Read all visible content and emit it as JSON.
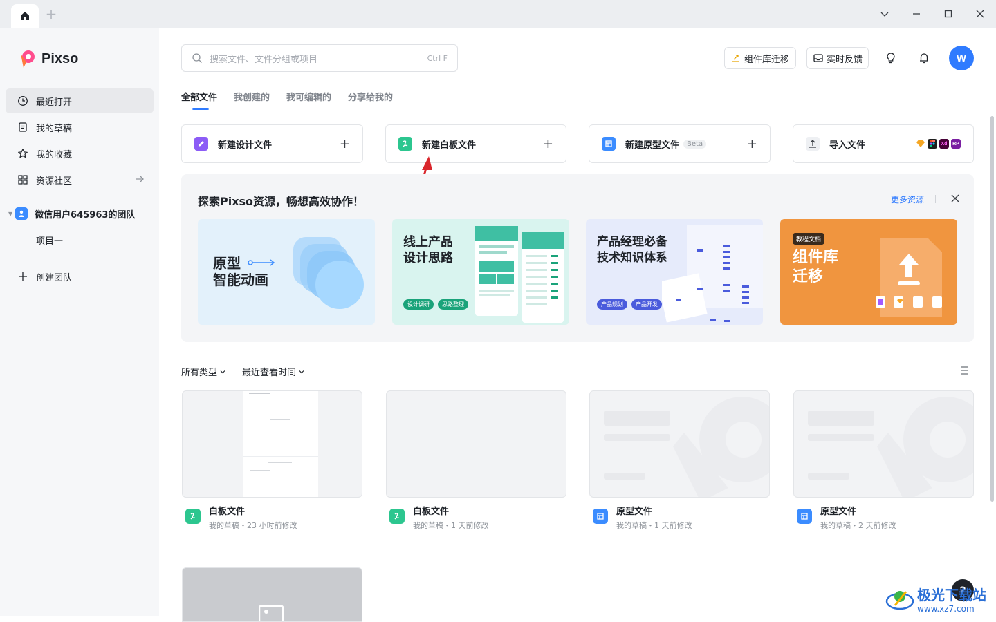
{
  "app": {
    "name": "Pixso"
  },
  "sidebar": {
    "items": [
      {
        "label": "最近打开",
        "icon": "clock-icon"
      },
      {
        "label": "我的草稿",
        "icon": "draft-icon"
      },
      {
        "label": "我的收藏",
        "icon": "star-icon"
      },
      {
        "label": "资源社区",
        "icon": "grid-icon"
      }
    ],
    "team": {
      "name": "微信用户645963的团队",
      "project": "项目一"
    },
    "create_team": "创建团队"
  },
  "search": {
    "placeholder": "搜索文件、文件分组或项目",
    "shortcut": "Ctrl F"
  },
  "header": {
    "migrate_label": "组件库迁移",
    "feedback_label": "实时反馈",
    "avatar_letter": "W"
  },
  "tabs": [
    "全部文件",
    "我创建的",
    "我可编辑的",
    "分享给我的"
  ],
  "create": {
    "design": "新建设计文件",
    "whiteboard": "新建白板文件",
    "prototype": "新建原型文件",
    "beta": "Beta",
    "import": "导入文件",
    "formats": [
      "Sketch",
      "Figma",
      "Xd",
      "RP"
    ]
  },
  "resources": {
    "title": "探索Pixso资源，畅想高效协作！",
    "more": "更多资源",
    "cards": [
      {
        "title_line1": "原型",
        "title_line2": "智能动画"
      },
      {
        "title_line1": "线上产品",
        "title_line2": "设计思路",
        "tags": [
          "设计调研",
          "思路整理"
        ]
      },
      {
        "title_line1": "产品经理必备",
        "title_line2": "技术知识体系",
        "tags": [
          "产品规划",
          "产品开发"
        ]
      },
      {
        "badge": "教程文档",
        "title_line1": "组件库",
        "title_line2": "迁移"
      }
    ]
  },
  "filters": {
    "type": "所有类型",
    "sort": "最近查看时间"
  },
  "files": [
    {
      "name": "白板文件",
      "meta": "我的草稿・23 小时前修改",
      "kind": "whiteboard"
    },
    {
      "name": "白板文件",
      "meta": "我的草稿・1 天前修改",
      "kind": "whiteboard"
    },
    {
      "name": "原型文件",
      "meta": "我的草稿・1 天前修改",
      "kind": "prototype"
    },
    {
      "name": "原型文件",
      "meta": "我的草稿・2 天前修改",
      "kind": "prototype"
    }
  ],
  "help": "?",
  "watermark": {
    "line1": "极光下载站",
    "line2": "www.xz7.com"
  },
  "colors": {
    "accent": "#2f7bff",
    "design": "#8c5cf6",
    "whiteboard": "#2cc68f",
    "prototype": "#3b8cff",
    "annotation_arrow": "#d9262c"
  }
}
